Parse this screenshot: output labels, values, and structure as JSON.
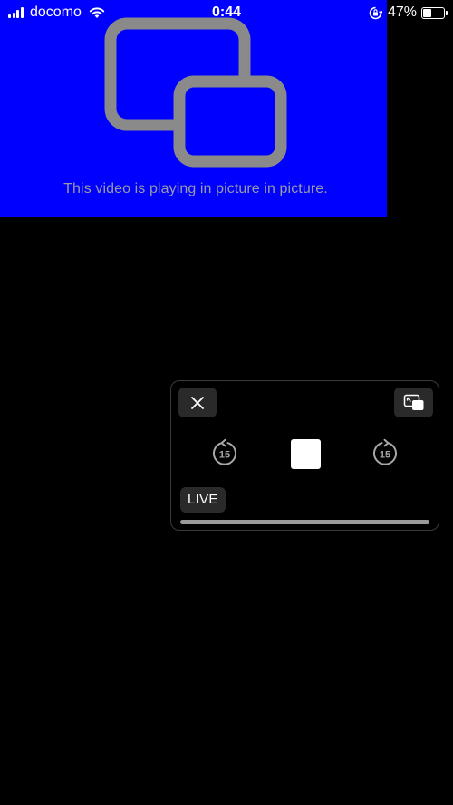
{
  "status_bar": {
    "carrier": "docomo",
    "time": "0:44",
    "battery_percent": "47%",
    "battery_level": 0.47,
    "signal_bars": 4,
    "icons": [
      "signal-bars-icon",
      "wifi-icon",
      "orientation-lock-icon",
      "battery-icon"
    ]
  },
  "video": {
    "background_color": "#0000ff",
    "icon": "picture-in-picture-icon",
    "message": "This video is playing in picture in picture."
  },
  "pip_window": {
    "close_icon": "close-icon",
    "restore_icon": "pip-restore-icon",
    "skip_back_label": "15",
    "skip_forward_label": "15",
    "stop_icon": "stop-icon",
    "live_label": "LIVE",
    "progress": 1.0
  }
}
